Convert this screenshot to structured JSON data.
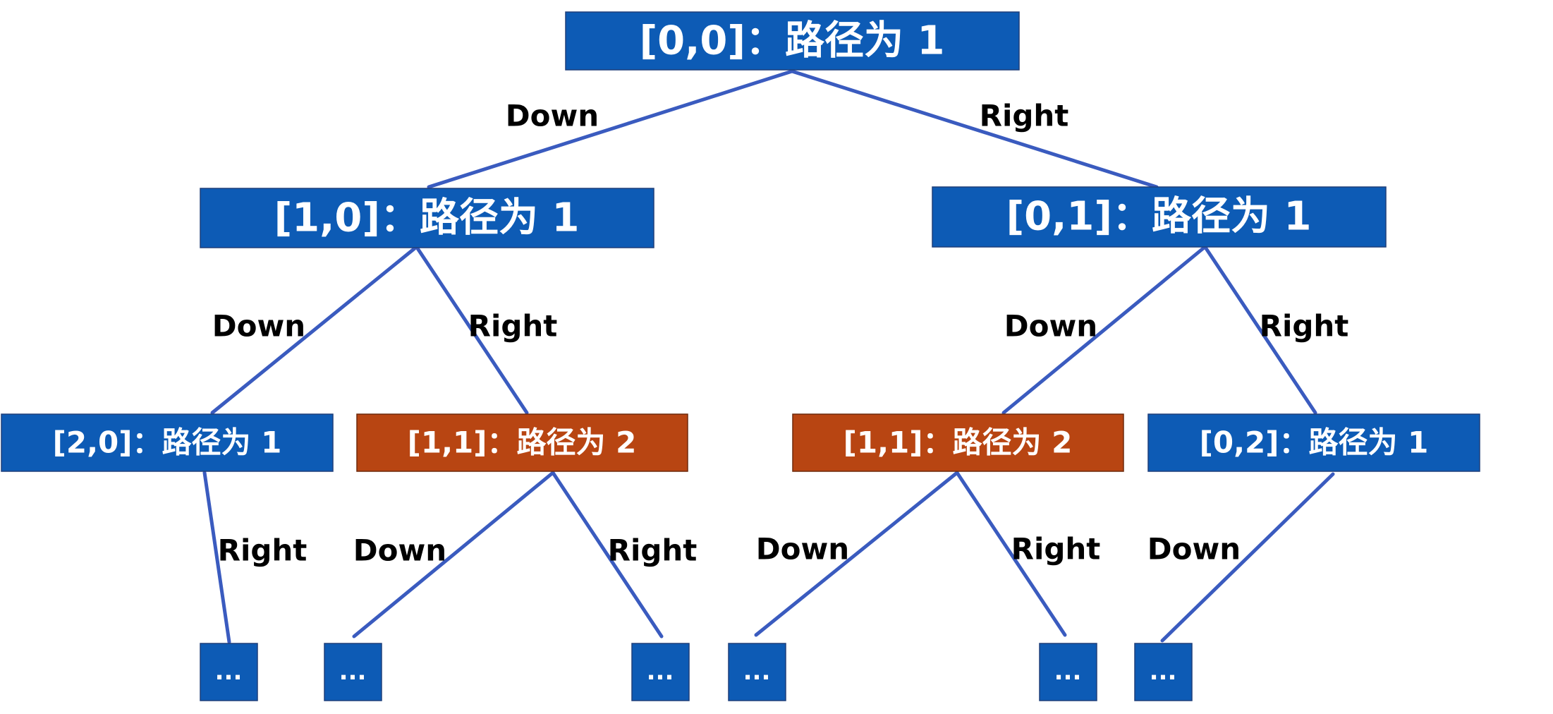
{
  "nodes": {
    "root": {
      "label": "[0,0]：路径为 1",
      "color": "blue"
    },
    "n10": {
      "label": "[1,0]：路径为 1",
      "color": "blue"
    },
    "n01": {
      "label": "[0,1]：路径为 1",
      "color": "blue"
    },
    "n20": {
      "label": "[2,0]：路径为 1",
      "color": "blue"
    },
    "n11a": {
      "label": "[1,1]：路径为 2",
      "color": "orange"
    },
    "n11b": {
      "label": "[1,1]：路径为 2",
      "color": "orange"
    },
    "n02": {
      "label": "[0,2]：路径为 1",
      "color": "blue"
    },
    "leaf1": {
      "label": "...",
      "color": "blue"
    },
    "leaf2": {
      "label": "...",
      "color": "blue"
    },
    "leaf3": {
      "label": "...",
      "color": "blue"
    },
    "leaf4": {
      "label": "...",
      "color": "blue"
    },
    "leaf5": {
      "label": "...",
      "color": "blue"
    },
    "leaf6": {
      "label": "...",
      "color": "blue"
    }
  },
  "edges": [
    {
      "from": "root",
      "to": "n10",
      "label": "Down"
    },
    {
      "from": "root",
      "to": "n01",
      "label": "Right"
    },
    {
      "from": "n10",
      "to": "n20",
      "label": "Down"
    },
    {
      "from": "n10",
      "to": "n11a",
      "label": "Right"
    },
    {
      "from": "n01",
      "to": "n11b",
      "label": "Down"
    },
    {
      "from": "n01",
      "to": "n02",
      "label": "Right"
    },
    {
      "from": "n20",
      "to": "leaf1",
      "label": "Right"
    },
    {
      "from": "n11a",
      "to": "leaf2",
      "label": "Down"
    },
    {
      "from": "n11a",
      "to": "leaf3",
      "label": "Right"
    },
    {
      "from": "n11b",
      "to": "leaf4",
      "label": "Down"
    },
    {
      "from": "n11b",
      "to": "leaf5",
      "label": "Right"
    },
    {
      "from": "n02",
      "to": "leaf6",
      "label": "Down"
    }
  ],
  "colors": {
    "blue": "#0d5bb5",
    "orange": "#b84512",
    "edge": "#3a5bbf"
  }
}
